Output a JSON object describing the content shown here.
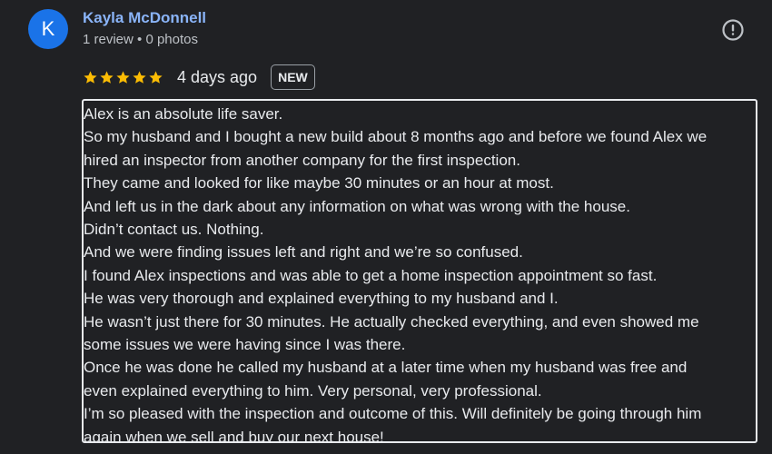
{
  "reviewer": {
    "avatar_letter": "K",
    "avatar_color": "#1a73e8",
    "name": "Kayla McDonnell",
    "meta": "1 review • 0 photos"
  },
  "report_icon": "exclamation-circle-icon",
  "rating": {
    "stars": 5,
    "max_stars": 5,
    "star_color": "#fbbc04",
    "time": "4 days ago",
    "badge": "NEW"
  },
  "review": {
    "lines": [
      "Alex is an absolute life saver.",
      "So my husband and I bought a new build about 8 months ago and before we found Alex we",
      "hired an inspector from another company for the first inspection.",
      "They came and looked for like maybe 30 minutes or an hour at most.",
      "And left us in the dark about any information on what was wrong with the house.",
      "Didn’t contact us. Nothing.",
      "And we were finding issues left and right and we’re so confused.",
      "I found Alex inspections and was able to get a home inspection appointment so fast.",
      "He was very thorough and explained everything to my husband and I.",
      "He wasn’t just there for 30 minutes. He actually checked everything, and even showed me",
      "some issues we were having since I was there.",
      "Once he was done he called my husband at a later time when my husband was free and",
      "even explained everything to him. Very personal, very professional.",
      "I’m so pleased with the inspection and outcome of this. Will definitely be going through him",
      "again when we sell and buy our next house!"
    ]
  }
}
